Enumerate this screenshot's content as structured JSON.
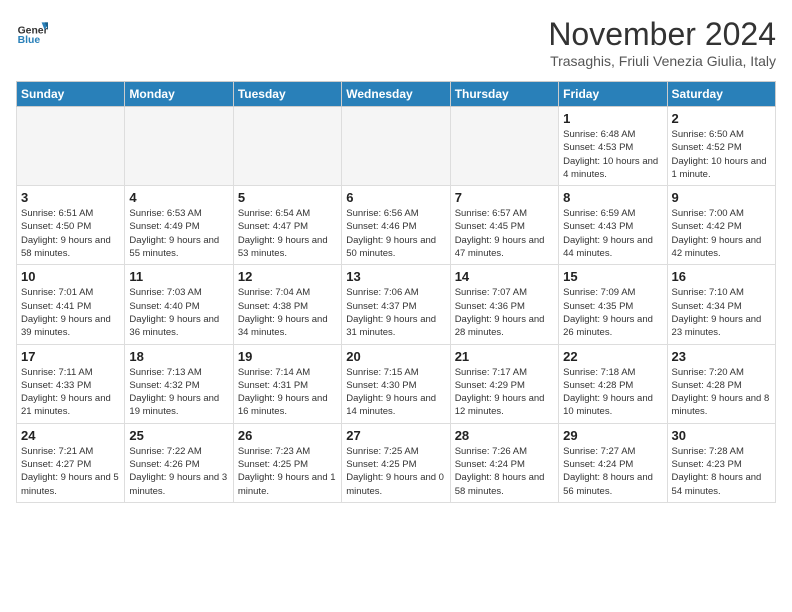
{
  "header": {
    "logo": {
      "general": "General",
      "blue": "Blue"
    },
    "title": "November 2024",
    "subtitle": "Trasaghis, Friuli Venezia Giulia, Italy"
  },
  "calendar": {
    "days_of_week": [
      "Sunday",
      "Monday",
      "Tuesday",
      "Wednesday",
      "Thursday",
      "Friday",
      "Saturday"
    ],
    "weeks": [
      [
        {
          "day": "",
          "info": "",
          "empty": true
        },
        {
          "day": "",
          "info": "",
          "empty": true
        },
        {
          "day": "",
          "info": "",
          "empty": true
        },
        {
          "day": "",
          "info": "",
          "empty": true
        },
        {
          "day": "",
          "info": "",
          "empty": true
        },
        {
          "day": "1",
          "info": "Sunrise: 6:48 AM\nSunset: 4:53 PM\nDaylight: 10 hours and 4 minutes."
        },
        {
          "day": "2",
          "info": "Sunrise: 6:50 AM\nSunset: 4:52 PM\nDaylight: 10 hours and 1 minute."
        }
      ],
      [
        {
          "day": "3",
          "info": "Sunrise: 6:51 AM\nSunset: 4:50 PM\nDaylight: 9 hours and 58 minutes."
        },
        {
          "day": "4",
          "info": "Sunrise: 6:53 AM\nSunset: 4:49 PM\nDaylight: 9 hours and 55 minutes."
        },
        {
          "day": "5",
          "info": "Sunrise: 6:54 AM\nSunset: 4:47 PM\nDaylight: 9 hours and 53 minutes."
        },
        {
          "day": "6",
          "info": "Sunrise: 6:56 AM\nSunset: 4:46 PM\nDaylight: 9 hours and 50 minutes."
        },
        {
          "day": "7",
          "info": "Sunrise: 6:57 AM\nSunset: 4:45 PM\nDaylight: 9 hours and 47 minutes."
        },
        {
          "day": "8",
          "info": "Sunrise: 6:59 AM\nSunset: 4:43 PM\nDaylight: 9 hours and 44 minutes."
        },
        {
          "day": "9",
          "info": "Sunrise: 7:00 AM\nSunset: 4:42 PM\nDaylight: 9 hours and 42 minutes."
        }
      ],
      [
        {
          "day": "10",
          "info": "Sunrise: 7:01 AM\nSunset: 4:41 PM\nDaylight: 9 hours and 39 minutes."
        },
        {
          "day": "11",
          "info": "Sunrise: 7:03 AM\nSunset: 4:40 PM\nDaylight: 9 hours and 36 minutes."
        },
        {
          "day": "12",
          "info": "Sunrise: 7:04 AM\nSunset: 4:38 PM\nDaylight: 9 hours and 34 minutes."
        },
        {
          "day": "13",
          "info": "Sunrise: 7:06 AM\nSunset: 4:37 PM\nDaylight: 9 hours and 31 minutes."
        },
        {
          "day": "14",
          "info": "Sunrise: 7:07 AM\nSunset: 4:36 PM\nDaylight: 9 hours and 28 minutes."
        },
        {
          "day": "15",
          "info": "Sunrise: 7:09 AM\nSunset: 4:35 PM\nDaylight: 9 hours and 26 minutes."
        },
        {
          "day": "16",
          "info": "Sunrise: 7:10 AM\nSunset: 4:34 PM\nDaylight: 9 hours and 23 minutes."
        }
      ],
      [
        {
          "day": "17",
          "info": "Sunrise: 7:11 AM\nSunset: 4:33 PM\nDaylight: 9 hours and 21 minutes."
        },
        {
          "day": "18",
          "info": "Sunrise: 7:13 AM\nSunset: 4:32 PM\nDaylight: 9 hours and 19 minutes."
        },
        {
          "day": "19",
          "info": "Sunrise: 7:14 AM\nSunset: 4:31 PM\nDaylight: 9 hours and 16 minutes."
        },
        {
          "day": "20",
          "info": "Sunrise: 7:15 AM\nSunset: 4:30 PM\nDaylight: 9 hours and 14 minutes."
        },
        {
          "day": "21",
          "info": "Sunrise: 7:17 AM\nSunset: 4:29 PM\nDaylight: 9 hours and 12 minutes."
        },
        {
          "day": "22",
          "info": "Sunrise: 7:18 AM\nSunset: 4:28 PM\nDaylight: 9 hours and 10 minutes."
        },
        {
          "day": "23",
          "info": "Sunrise: 7:20 AM\nSunset: 4:28 PM\nDaylight: 9 hours and 8 minutes."
        }
      ],
      [
        {
          "day": "24",
          "info": "Sunrise: 7:21 AM\nSunset: 4:27 PM\nDaylight: 9 hours and 5 minutes."
        },
        {
          "day": "25",
          "info": "Sunrise: 7:22 AM\nSunset: 4:26 PM\nDaylight: 9 hours and 3 minutes."
        },
        {
          "day": "26",
          "info": "Sunrise: 7:23 AM\nSunset: 4:25 PM\nDaylight: 9 hours and 1 minute."
        },
        {
          "day": "27",
          "info": "Sunrise: 7:25 AM\nSunset: 4:25 PM\nDaylight: 9 hours and 0 minutes."
        },
        {
          "day": "28",
          "info": "Sunrise: 7:26 AM\nSunset: 4:24 PM\nDaylight: 8 hours and 58 minutes."
        },
        {
          "day": "29",
          "info": "Sunrise: 7:27 AM\nSunset: 4:24 PM\nDaylight: 8 hours and 56 minutes."
        },
        {
          "day": "30",
          "info": "Sunrise: 7:28 AM\nSunset: 4:23 PM\nDaylight: 8 hours and 54 minutes."
        }
      ]
    ]
  }
}
